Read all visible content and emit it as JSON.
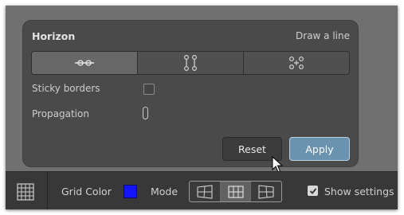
{
  "panel": {
    "title": "Horizon",
    "hint": "Draw a line",
    "segments": [
      {
        "icon": "horizon-line-icon",
        "active": true
      },
      {
        "icon": "vertical-lines-icon",
        "active": false
      },
      {
        "icon": "points-icon",
        "active": false
      }
    ],
    "sticky_borders_label": "Sticky borders",
    "sticky_borders_checked": false,
    "propagation_label": "Propagation",
    "reset_label": "Reset",
    "apply_label": "Apply"
  },
  "toolbar": {
    "grid_icon": "grid-icon",
    "grid_color_label": "Grid Color",
    "grid_color": "#1414ff",
    "mode_label": "Mode",
    "modes": [
      {
        "icon": "perspective-grid-left-icon",
        "active": false
      },
      {
        "icon": "perspective-grid-center-icon",
        "active": true
      },
      {
        "icon": "perspective-grid-right-icon",
        "active": false
      }
    ],
    "show_settings_label": "Show settings",
    "show_settings_checked": true
  },
  "colors": {
    "accent_apply": "#6b93b0",
    "panel_bg": "#4a4a4a",
    "toolbar_bg": "#383838"
  }
}
